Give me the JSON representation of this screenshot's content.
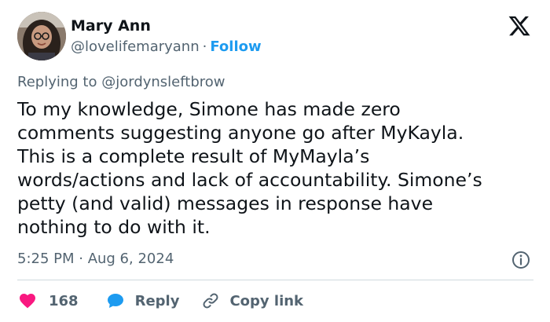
{
  "author": {
    "name": "Mary Ann",
    "handle": "@lovelifemaryann",
    "separator": "·",
    "follow_label": "Follow"
  },
  "icons": {
    "logo": "x-logo-icon",
    "info": "info-icon",
    "like": "heart-icon",
    "reply": "speech-bubble-icon",
    "copy": "link-icon"
  },
  "colors": {
    "accent": "#1d9bf0",
    "like": "#f91880",
    "muted_text": "#536471",
    "text": "#0f1419",
    "divider": "#cfd9de"
  },
  "reply_context": {
    "prefix": "Replying to",
    "mention": "@jordynsleftbrow"
  },
  "tweet": {
    "lines": [
      "To my knowledge, Simone has made zero",
      "comments suggesting anyone go after MyKayla.",
      "This is a complete result of MyMayla’s",
      "words/actions and lack of accountability. Simone’s",
      "petty (and valid) messages in response have",
      "nothing to do with it."
    ],
    "timestamp": "5:25 PM · Aug 6, 2024"
  },
  "actions": {
    "like_count": "168",
    "reply_label": "Reply",
    "copy_label": "Copy link"
  }
}
